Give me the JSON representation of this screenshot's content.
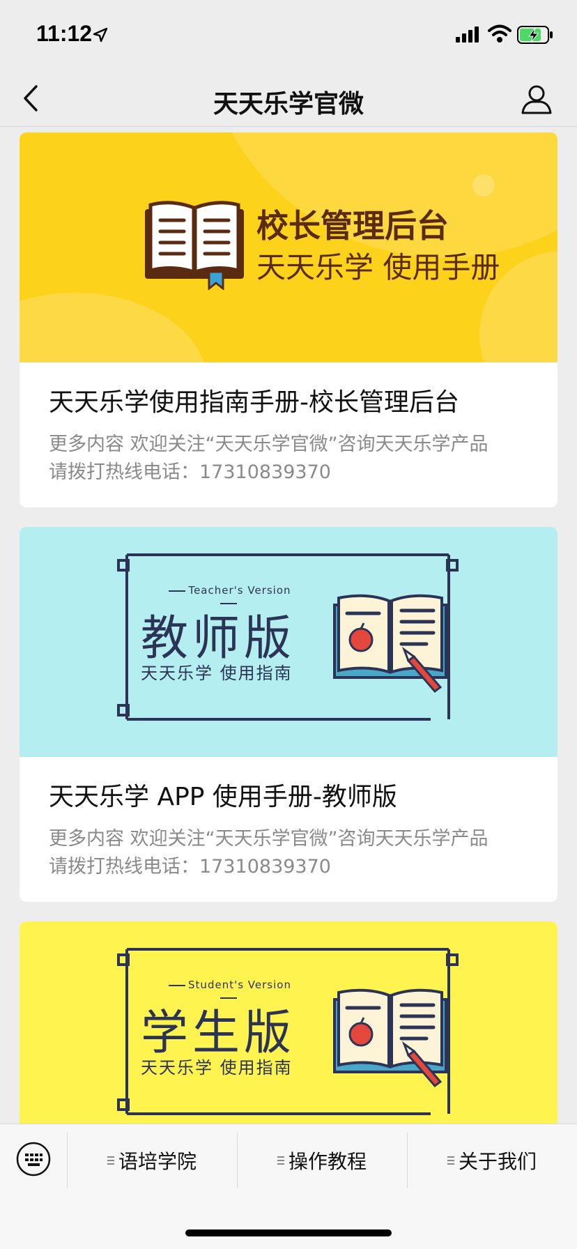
{
  "status_bar": {
    "time": "11:12"
  },
  "nav": {
    "title": "天天乐学官微"
  },
  "articles": [
    {
      "banner": {
        "line1": "校长管理后台",
        "line2": "天天乐学 使用手册"
      },
      "title": "天天乐学使用指南手册-校长管理后台",
      "desc_line1": "更多内容 欢迎关注“天天乐学官微”咨询天天乐学产品",
      "desc_line2": "请拨打热线电话：17310839370"
    },
    {
      "banner": {
        "eng": "Teacher's Version",
        "big": "教师版",
        "small": "天天乐学 使用指南"
      },
      "title": "天天乐学 APP 使用手册-教师版",
      "desc_line1": "更多内容 欢迎关注“天天乐学官微”咨询天天乐学产品",
      "desc_line2": "请拨打热线电话：17310839370"
    },
    {
      "banner": {
        "eng": "Student's Version",
        "big": "学生版",
        "small": "天天乐学 使用指南"
      }
    }
  ],
  "bottom_menu": {
    "items": [
      "语培学院",
      "操作教程",
      "关于我们"
    ]
  },
  "colors": {
    "banner1": "#fdd21a",
    "banner2": "#b5eef0",
    "banner3": "#fff44f",
    "banner_text": "#2c3456"
  }
}
